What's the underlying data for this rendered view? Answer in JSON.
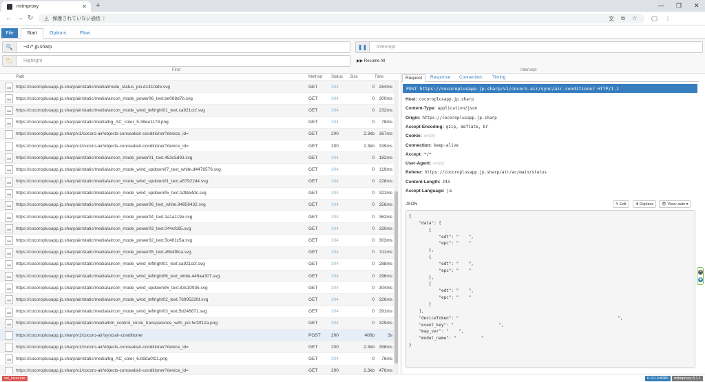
{
  "browser": {
    "tab_title": "mitmproxy",
    "url_warning": "保護されていない通信",
    "url": ""
  },
  "menu": {
    "file": "File",
    "tabs": [
      "Start",
      "Options",
      "Flow"
    ]
  },
  "toolbar": {
    "search_value": "~d /*.jp.sharp",
    "highlight_placeholder": "Highlight",
    "intercept_placeholder": "Intercept",
    "find_label": "Find",
    "intercept_label": "Intercept",
    "resume_all": "Resume All"
  },
  "flow_table": {
    "columns": [
      "Path",
      "Method",
      "Status",
      "Size",
      "Time"
    ],
    "rows": [
      {
        "path": "https://cocoroplusapp.jp.sharp/air/static/media/mode_status_pci.d1410afe.svg",
        "method": "GET",
        "status": "304",
        "size": "0",
        "time": "264ms",
        "icon": "304"
      },
      {
        "path": "https://cocoroplusapp.jp.sharp/air/static/media/aircon_mode_power06_text.be088d7b.svg",
        "method": "GET",
        "status": "304",
        "size": "0",
        "time": "300ms",
        "icon": "304"
      },
      {
        "path": "https://cocoroplusapp.jp.sharp/air/static/media/aircon_mode_wind_leftright01_text.ca921ccf.svg",
        "method": "GET",
        "status": "304",
        "size": "0",
        "time": "232ms",
        "icon": "304"
      },
      {
        "path": "https://cocoroplusapp.jp.sharp/air/static/media/bg_AC_color_5.38ee1178.png",
        "method": "GET",
        "status": "304",
        "size": "0",
        "time": "78ms",
        "icon": "304"
      },
      {
        "path": "https://cocoroplusapp.jp.sharp/v1/cocoro-air/objects-conceal/air-conditioner?device_id=",
        "method": "GET",
        "status": "200",
        "size": "2.3kb",
        "time": "367ms",
        "icon": ""
      },
      {
        "path": "https://cocoroplusapp.jp.sharp/v1/cocoro-air/objects-conceal/air-conditioner?device_id=",
        "method": "GET",
        "status": "200",
        "size": "2.3kb",
        "time": "339ms",
        "icon": ""
      },
      {
        "path": "https://cocoroplusapp.jp.sharp/air/static/media/aircon_mode_power01_text.452c5d93.svg",
        "method": "GET",
        "status": "304",
        "size": "0",
        "time": "182ms",
        "icon": "304"
      },
      {
        "path": "https://cocoroplusapp.jp.sharp/air/static/media/aircon_mode_wind_updown07_text_white.d4478576.svg",
        "method": "GET",
        "status": "304",
        "size": "0",
        "time": "119ms",
        "icon": "304"
      },
      {
        "path": "https://cocoroplusapp.jp.sharp/air/static/media/aircon_mode_wind_updown01_text.a57922d4.svg",
        "method": "GET",
        "status": "304",
        "size": "0",
        "time": "228ms",
        "icon": "304"
      },
      {
        "path": "https://cocoroplusapp.jp.sharp/air/static/media/aircon_mode_wind_updown05_text.1dfde4dc.svg",
        "method": "GET",
        "status": "304",
        "size": "0",
        "time": "321ms",
        "icon": "304"
      },
      {
        "path": "https://cocoroplusapp.jp.sharp/air/static/media/aircon_mode_power06_text_white.84856432.svg",
        "method": "GET",
        "status": "304",
        "size": "0",
        "time": "356ms",
        "icon": "304"
      },
      {
        "path": "https://cocoroplusapp.jp.sharp/air/static/media/aircon_mode_power04_text.1a1a119e.svg",
        "method": "GET",
        "status": "304",
        "size": "0",
        "time": "362ms",
        "icon": "304"
      },
      {
        "path": "https://cocoroplusapp.jp.sharp/air/static/media/aircon_mode_power03_text.044cfc85.svg",
        "method": "GET",
        "status": "304",
        "size": "0",
        "time": "330ms",
        "icon": "304"
      },
      {
        "path": "https://cocoroplusapp.jp.sharp/air/static/media/aircon_mode_power02_text.5c481c5a.svg",
        "method": "GET",
        "status": "304",
        "size": "0",
        "time": "303ms",
        "icon": "304"
      },
      {
        "path": "https://cocoroplusapp.jp.sharp/air/static/media/aircon_mode_power05_text.a5b4f8ca.svg",
        "method": "GET",
        "status": "304",
        "size": "0",
        "time": "311ms",
        "icon": "304"
      },
      {
        "path": "https://cocoroplusapp.jp.sharp/air/static/media/aircon_mode_wind_leftright01_text.ca921ccf.svg",
        "method": "GET",
        "status": "304",
        "size": "0",
        "time": "288ms",
        "icon": "304"
      },
      {
        "path": "https://cocoroplusapp.jp.sharp/air/static/media/aircon_mode_wind_leftright06_text_white.449aa307.svg",
        "method": "GET",
        "status": "304",
        "size": "0",
        "time": "296ms",
        "icon": "304"
      },
      {
        "path": "https://cocoroplusapp.jp.sharp/air/static/media/aircon_mode_wind_updown06_text.83c10935.svg",
        "method": "GET",
        "status": "304",
        "size": "0",
        "time": "304ms",
        "icon": "304"
      },
      {
        "path": "https://cocoroplusapp.jp.sharp/air/static/media/aircon_mode_wind_leftright02_text.7699522fd.svg",
        "method": "GET",
        "status": "304",
        "size": "0",
        "time": "326ms",
        "icon": "304"
      },
      {
        "path": "https://cocoroplusapp.jp.sharp/air/static/media/aircon_mode_wind_leftright03_text.5d246671.svg",
        "method": "GET",
        "status": "304",
        "size": "0",
        "time": "291ms",
        "icon": "304"
      },
      {
        "path": "https://cocoroplusapp.jp.sharp/air/static/media/btn_control_circle_transparence_with_pci.5cf2f12a.png",
        "method": "GET",
        "status": "304",
        "size": "0",
        "time": "329ms",
        "icon": "304"
      },
      {
        "path": "https://cocoroplusapp.jp.sharp/v1/cocoro-air/sync/air-conditioner",
        "method": "POST",
        "status": "200",
        "size": "406b",
        "time": "3s",
        "icon": "",
        "selected": true
      },
      {
        "path": "https://cocoroplusapp.jp.sharp/v1/cocoro-air/objects-conceal/air-conditioner?device_id=",
        "method": "GET",
        "status": "200",
        "size": "2.3kb",
        "time": "398ms",
        "icon": ""
      },
      {
        "path": "https://cocoroplusapp.jp.sharp/air/static/media/bg_AC_color_6.b9da0f21.png",
        "method": "GET",
        "status": "304",
        "size": "0",
        "time": "76ms",
        "icon": "304"
      },
      {
        "path": "https://cocoroplusapp.jp.sharp/v1/cocoro-air/objects-conceal/air-conditioner?device_id=",
        "method": "GET",
        "status": "200",
        "size": "2.3kb",
        "time": "476ms",
        "icon": ""
      }
    ]
  },
  "detail": {
    "tabs": [
      "Request",
      "Response",
      "Connection",
      "Timing"
    ],
    "request_line": "POST https://cocoroplusapp.jp.sharp/v1/cocoro-air/sync/air-conditioner HTTP/1.1",
    "headers": [
      {
        "name": "Host:",
        "value": "cocoroplusapp.jp.sharp",
        "empty": false
      },
      {
        "name": "Content-Type:",
        "value": "application/json",
        "empty": false
      },
      {
        "name": "Origin:",
        "value": "https://cocoroplusapp.jp.sharp",
        "empty": false
      },
      {
        "name": "Accept-Encoding:",
        "value": "gzip, deflate, br",
        "empty": false
      },
      {
        "name": "Cookie:",
        "value": "empty",
        "empty": true
      },
      {
        "name": "Connection:",
        "value": "keep-alive",
        "empty": false
      },
      {
        "name": "Accept:",
        "value": "*/*",
        "empty": false
      },
      {
        "name": "User-Agent:",
        "value": "empty",
        "empty": true
      },
      {
        "name": "Referer:",
        "value": "https://cocoroplusapp.jp.sharp/air/ac/main/status",
        "empty": false
      },
      {
        "name": "Content-Length:",
        "value": "243",
        "empty": false
      },
      {
        "name": "Accept-Language:",
        "value": "ja",
        "empty": false
      }
    ],
    "json_label": "JSON",
    "edit": "Edit",
    "replace": "Replace",
    "view": "View: auto",
    "json_body": "{\n    \"data\": [\n        {\n            \"edt\": \"    \",\n            \"epc\": \"    \"\n        },\n        {\n            \"edt\": \"    \",\n            \"epc\": \"    \"\n        },\n        {\n            \"edt\": \"    \",\n            \"epc\": \"    \"\n        }\n    ],\n    \"deviceToken\": \"                                                                \",\n    \"event_key\": \"                  \",\n    \"map_ver\": \"    \",\n    \"model_name\": \"          \"\n}"
  },
  "footer": {
    "left_badge": "ssl_insecure",
    "addr": "0.0.0.0:8080",
    "version": "mitmproxy 8.1.1"
  },
  "colors": {
    "accent": "#387ebf",
    "status_dim": "#8ab4cf",
    "badge_red": "#d9534f",
    "badge_blue": "#337ab7",
    "badge_gray": "#777777"
  }
}
